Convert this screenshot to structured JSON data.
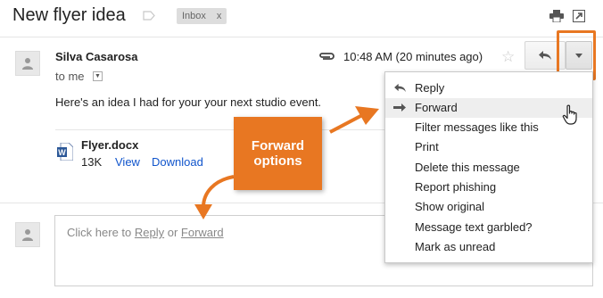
{
  "header": {
    "subject": "New flyer idea",
    "label_chip": "Inbox",
    "label_chip_close": "x"
  },
  "message": {
    "sender": "Silva Casarosa",
    "recipient": "to me",
    "time": "10:48 AM (20 minutes ago)",
    "body": "Here's an idea I had for your your next studio event.",
    "attachment": {
      "name": "Flyer.docx",
      "size": "13K",
      "view": "View",
      "download": "Download"
    }
  },
  "reply_box": {
    "prefix": "Click here to ",
    "reply": "Reply",
    "or": " or ",
    "forward": "Forward"
  },
  "menu": {
    "items": [
      {
        "label": "Reply",
        "icon": "reply-arrow-icon"
      },
      {
        "label": "Forward",
        "icon": "forward-arrow-icon"
      },
      {
        "label": "Filter messages like this"
      },
      {
        "label": "Print"
      },
      {
        "label": "Delete this message"
      },
      {
        "label": "Report phishing"
      },
      {
        "label": "Show original"
      },
      {
        "label": "Message text garbled?"
      },
      {
        "label": "Mark as unread"
      }
    ],
    "hovered_index": 1
  },
  "callout": {
    "line1": "Forward",
    "line2": "options"
  },
  "colors": {
    "accent_orange": "#e87722",
    "link_blue": "#1155cc",
    "menu_hover": "#eeeeee"
  }
}
